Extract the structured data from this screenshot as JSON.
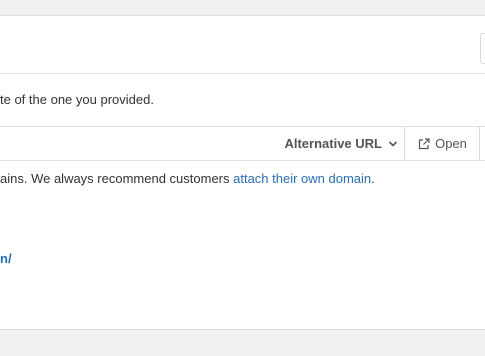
{
  "description": {
    "text": "te of the one you provided."
  },
  "url_row": {
    "dropdown_label": "Alternative URL",
    "open_label": "Open"
  },
  "note": {
    "prefix": "ains. We always recommend customers ",
    "link_text": "attach their own domain",
    "suffix": "."
  },
  "link": {
    "text": "n/"
  },
  "icons": {
    "dropdown": "chevron-down-icon",
    "open": "external-link-icon"
  },
  "colors": {
    "link": "#2a6fb0",
    "url_link": "#1f6fb5",
    "background": "#f1f1f1",
    "panel": "#ffffff"
  }
}
